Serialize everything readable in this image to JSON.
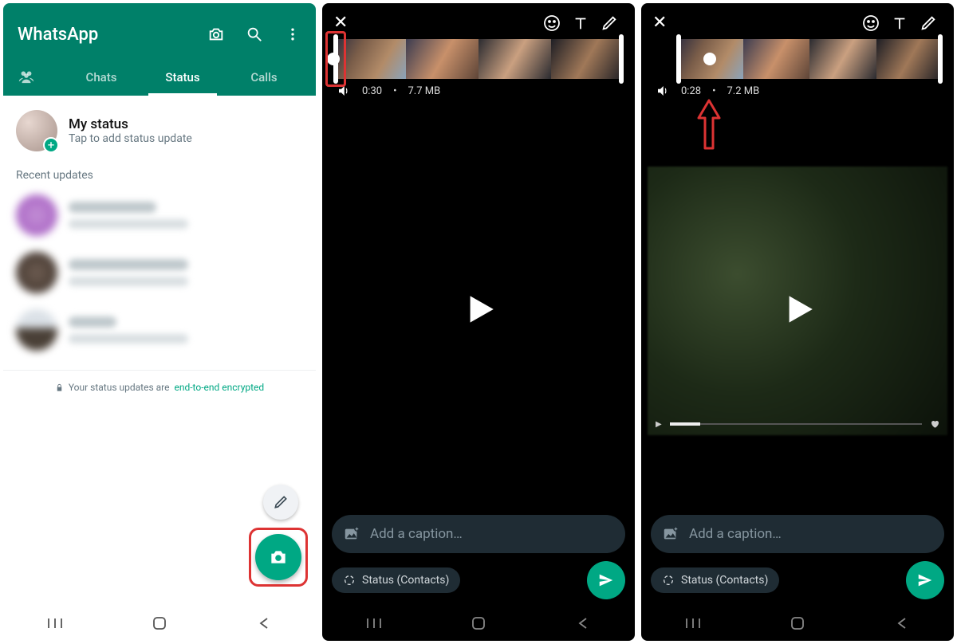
{
  "colors": {
    "brand": "#008069",
    "accent": "#00a884",
    "highlight": "#d33"
  },
  "screen1": {
    "app_name": "WhatsApp",
    "tabs": {
      "chats": "Chats",
      "status": "Status",
      "calls": "Calls"
    },
    "my_status": {
      "title": "My status",
      "subtitle": "Tap to add status update"
    },
    "section_recent": "Recent updates",
    "e2e_prefix": "Your status updates are ",
    "e2e_link": "end-to-end encrypted"
  },
  "screen2": {
    "duration": "0:30",
    "size": "7.7 MB",
    "caption_placeholder": "Add a caption…",
    "chip": "Status (Contacts)"
  },
  "screen3": {
    "duration": "0:28",
    "size": "7.2 MB",
    "caption_placeholder": "Add a caption…",
    "chip": "Status (Contacts)"
  }
}
